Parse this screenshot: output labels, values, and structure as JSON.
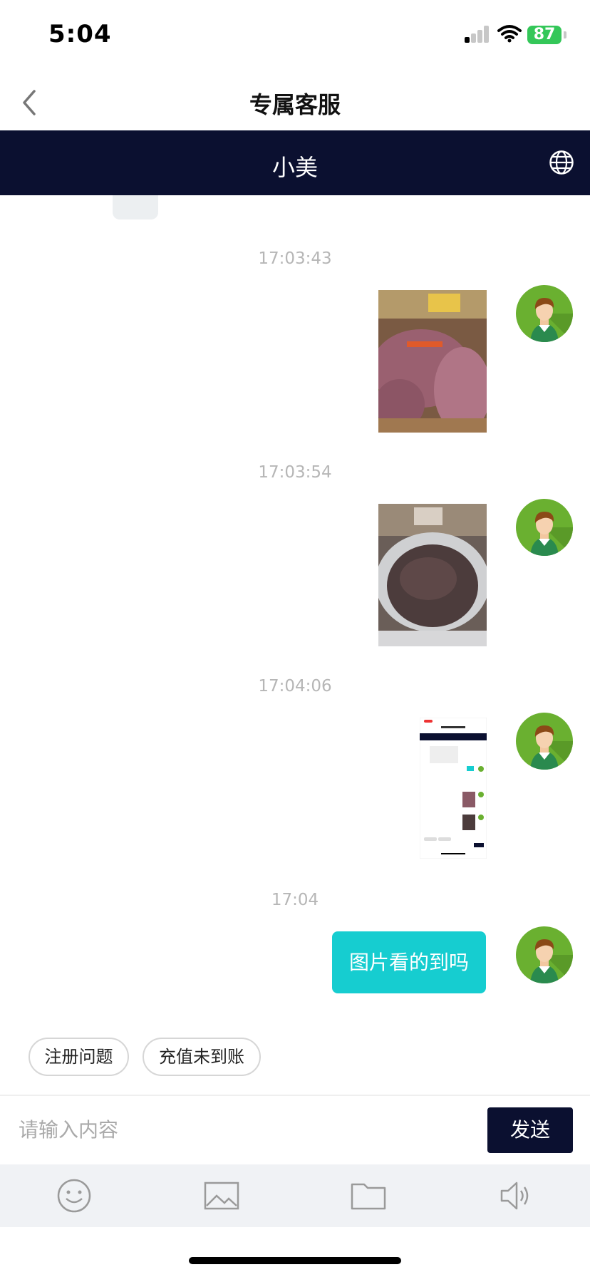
{
  "status_bar": {
    "time": "5:04",
    "battery": "87"
  },
  "header": {
    "title": "专属客服",
    "back_icon": "chevron-left-icon"
  },
  "agent_bar": {
    "name": "小美",
    "language_icon": "globe-icon"
  },
  "messages": [
    {
      "timestamp": "17:03:43",
      "type": "image",
      "content": "mushrooms-market-photo",
      "avatar": "user-avatar-icon"
    },
    {
      "timestamp": "17:03:54",
      "type": "image",
      "content": "dried-mushrooms-sack-photo",
      "avatar": "user-avatar-icon"
    },
    {
      "timestamp": "17:04:06",
      "type": "image",
      "content": "chat-screenshot-thumbnail",
      "avatar": "user-avatar-icon"
    },
    {
      "timestamp": "17:04",
      "type": "text",
      "content": "图片看的到吗",
      "avatar": "user-avatar-icon"
    }
  ],
  "quick_replies": [
    "注册问题",
    "充值未到账"
  ],
  "composer": {
    "placeholder": "请输入内容",
    "send_label": "发送"
  },
  "toolbar": {
    "icons": [
      "emoji-icon",
      "image-icon",
      "folder-icon",
      "speaker-icon"
    ]
  },
  "colors": {
    "agent_bar": "#0b1030",
    "bubble": "#16cdd0",
    "avatar_bg": "#6ab030"
  }
}
